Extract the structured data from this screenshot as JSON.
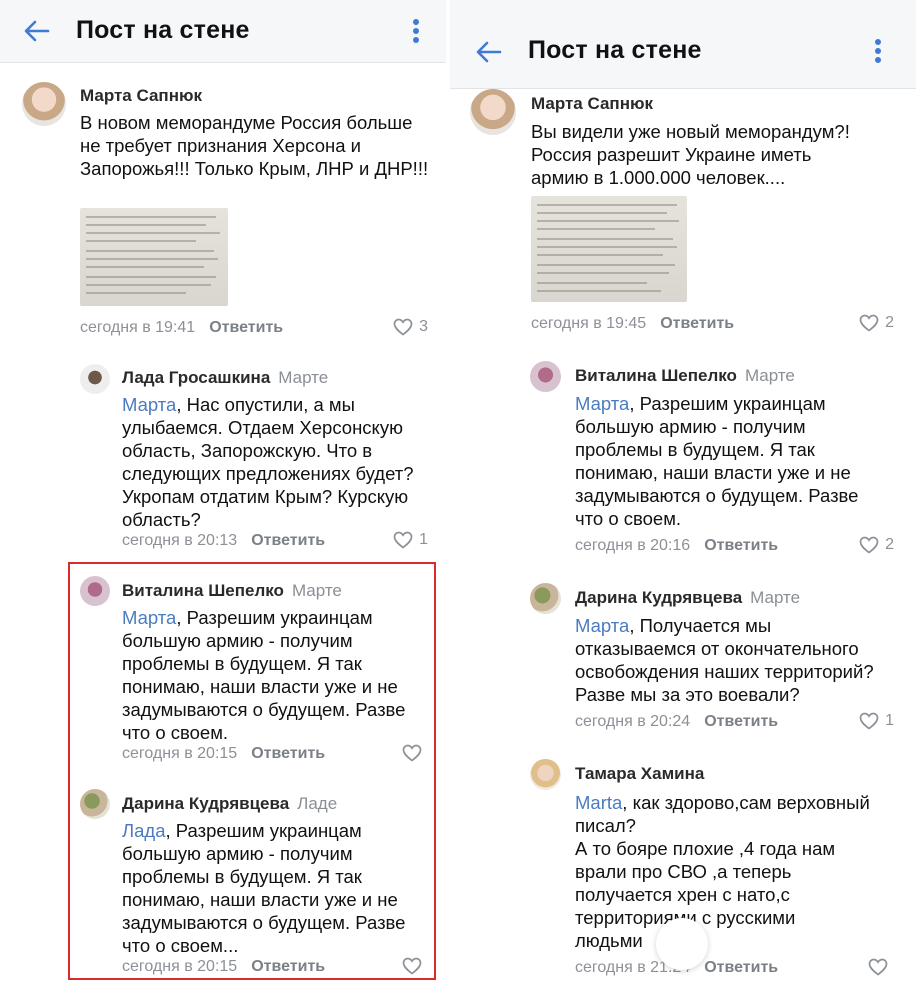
{
  "left": {
    "header": {
      "title": "Пост на стене"
    },
    "post": {
      "author": "Марта Сапнюк",
      "text": "В новом меморандуме Россия больше не требует признания Херсона и Запорожья!!! Только Крым, ЛНР и ДНР!!!",
      "time": "сегодня в 19:41",
      "reply_label": "Ответить",
      "likes": "3"
    },
    "comments": [
      {
        "author": "Лада Гросашкина",
        "reply_to": "Марте",
        "mention": "Марта",
        "text": ", Нас опустили, а мы улыбаемся. Отдаем Херсонскую область, Запорожскую. Что в следующих предложениях будет? Укропам отдатим Крым? Курскую область?",
        "time": "сегодня в 20:13",
        "reply_label": "Ответить",
        "likes": "1"
      },
      {
        "author": "Виталина Шепелко",
        "reply_to": "Марте",
        "mention": "Марта",
        "text": ", Разрешим украинцам большую армию - получим проблемы в будущем. Я так понимаю, наши власти уже и не задумываются о будущем. Разве что о своем.",
        "time": "сегодня в 20:15",
        "reply_label": "Ответить",
        "likes": ""
      },
      {
        "author": "Дарина Кудрявцева",
        "reply_to": "Ладе",
        "mention": "Лада",
        "text": ", Разрешим украинцам большую армию - получим проблемы в будущем. Я так понимаю, наши власти уже и не задумываются о будущем. Разве что о своем...",
        "time": "сегодня в 20:15",
        "reply_label": "Ответить",
        "likes": ""
      }
    ]
  },
  "right": {
    "header": {
      "title": "Пост на стене"
    },
    "post": {
      "author": "Марта Сапнюк",
      "text": "Вы видели уже новый меморандум?! Россия разрешит Украине иметь армию в 1.000.000 человек....",
      "time": "сегодня в 19:45",
      "reply_label": "Ответить",
      "likes": "2"
    },
    "comments": [
      {
        "author": "Виталина Шепелко",
        "reply_to": "Марте",
        "mention": "Марта",
        "text": ", Разрешим украинцам большую армию - получим проблемы в будущем. Я так понимаю, наши власти уже и не задумываются о будущем. Разве что о своем.",
        "time": "сегодня в 20:16",
        "reply_label": "Ответить",
        "likes": "2"
      },
      {
        "author": "Дарина Кудрявцева",
        "reply_to": "Марте",
        "mention": "Марта",
        "text": ", Получается мы отказываемся от окончательного освобождения наших территорий? Разве мы за это воевали?",
        "time": "сегодня в 20:24",
        "reply_label": "Ответить",
        "likes": "1"
      },
      {
        "author": "Тамара Хамина",
        "reply_to": "",
        "mention": "Marta",
        "text_lines": [
          ", как здорово,сам верховный писал?",
          "А то бояре плохие ,4 года нам врали про СВО ,а теперь получается хрен с нато,с территориями с русскими людьми"
        ],
        "time": "сегодня в 21:24",
        "reply_label": "Ответить",
        "likes": ""
      }
    ]
  },
  "colors": {
    "accent": "#4a7cbf",
    "highlight": "#d92b2b",
    "meta": "#8c9097",
    "header_bg": "#f6f7f9"
  }
}
